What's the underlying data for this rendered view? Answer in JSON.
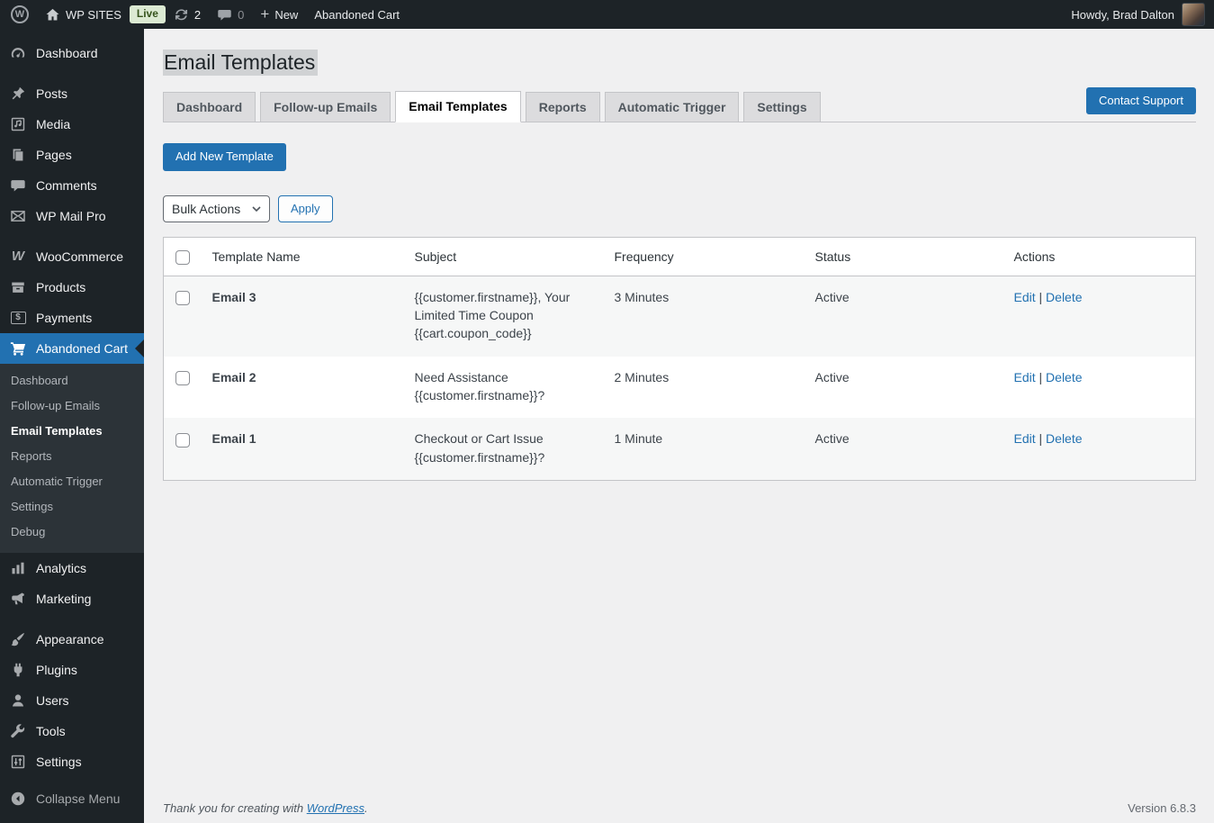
{
  "admin_bar": {
    "site_name": "WP SITES",
    "live_badge": "Live",
    "update_count": "2",
    "comment_count": "0",
    "new_label": "New",
    "page_label": "Abandoned Cart",
    "howdy": "Howdy, Brad Dalton"
  },
  "sidebar": {
    "items": [
      {
        "label": "Dashboard"
      },
      {
        "label": "Posts"
      },
      {
        "label": "Media"
      },
      {
        "label": "Pages"
      },
      {
        "label": "Comments"
      },
      {
        "label": "WP Mail Pro"
      },
      {
        "label": "WooCommerce"
      },
      {
        "label": "Products"
      },
      {
        "label": "Payments"
      },
      {
        "label": "Abandoned Cart"
      },
      {
        "label": "Analytics"
      },
      {
        "label": "Marketing"
      },
      {
        "label": "Appearance"
      },
      {
        "label": "Plugins"
      },
      {
        "label": "Users"
      },
      {
        "label": "Tools"
      },
      {
        "label": "Settings"
      }
    ],
    "submenu": {
      "parent": "Abandoned Cart",
      "items": [
        {
          "label": "Dashboard"
        },
        {
          "label": "Follow-up Emails"
        },
        {
          "label": "Email Templates"
        },
        {
          "label": "Reports"
        },
        {
          "label": "Automatic Trigger"
        },
        {
          "label": "Settings"
        },
        {
          "label": "Debug"
        }
      ],
      "current": "Email Templates"
    },
    "collapse_label": "Collapse Menu"
  },
  "page": {
    "title": "Email Templates",
    "tabs": [
      "Dashboard",
      "Follow-up Emails",
      "Email Templates",
      "Reports",
      "Automatic Trigger",
      "Settings"
    ],
    "active_tab": "Email Templates",
    "contact_support": "Contact Support",
    "add_new": "Add New Template",
    "bulk_actions": {
      "selected": "Bulk Actions",
      "apply": "Apply"
    }
  },
  "table": {
    "headers": [
      "Template Name",
      "Subject",
      "Frequency",
      "Status",
      "Actions"
    ],
    "action_edit": "Edit",
    "action_separator": "|",
    "action_delete": "Delete",
    "rows": [
      {
        "name": "Email 3",
        "subject": "{{customer.firstname}}, Your Limited Time Coupon {{cart.coupon_code}}",
        "frequency": "3 Minutes",
        "status": "Active"
      },
      {
        "name": "Email 2",
        "subject": "Need Assistance {{customer.firstname}}?",
        "frequency": "2 Minutes",
        "status": "Active"
      },
      {
        "name": "Email 1",
        "subject": "Checkout or Cart Issue {{customer.firstname}}?",
        "frequency": "1 Minute",
        "status": "Active"
      }
    ]
  },
  "footer": {
    "thanks_prefix": "Thank you for creating with ",
    "wordpress_link": "WordPress",
    "thanks_suffix": ".",
    "version": "Version 6.8.3"
  },
  "colors": {
    "accent_blue": "#2271b1",
    "status_green": "#46b450",
    "live_badge_bg": "#dcead3",
    "admin_dark": "#1d2327",
    "content_bg": "#f0f0f1"
  }
}
